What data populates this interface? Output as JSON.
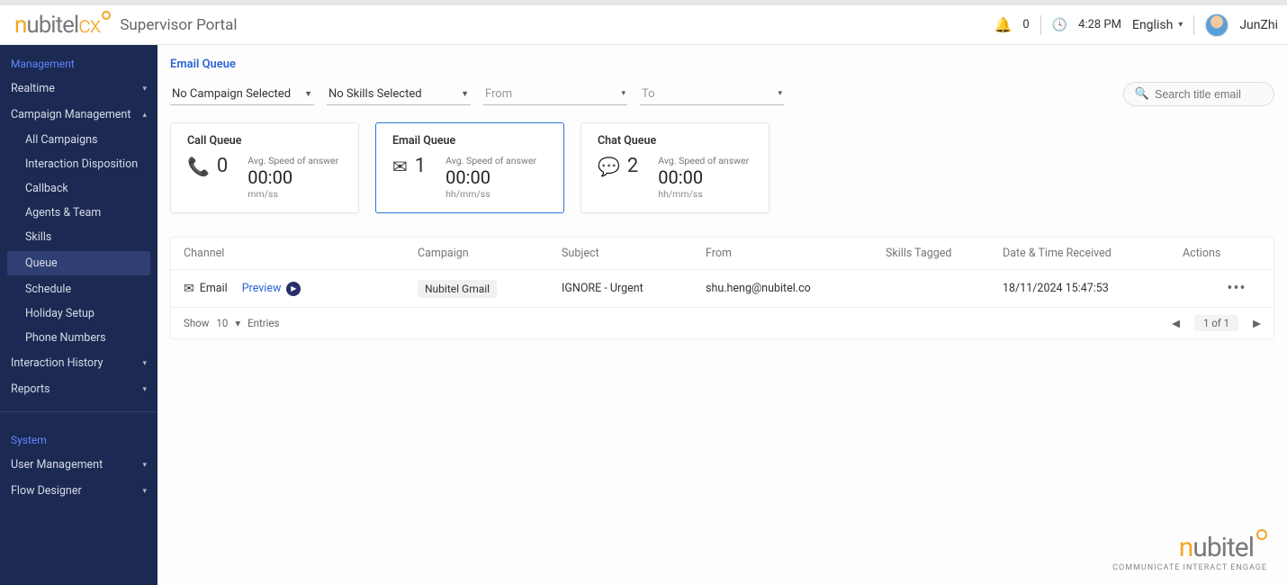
{
  "header": {
    "brand_head": "n",
    "brand_tail": "ubitel",
    "brand_cx": "cx",
    "portal": "Supervisor Portal",
    "notif_count": "0",
    "time": "4:28 PM",
    "language": "English",
    "username": "JunZhi"
  },
  "sidebar": {
    "section_management": "Management",
    "realtime": "Realtime",
    "campaign_mgmt": "Campaign Management",
    "subs": {
      "all_campaigns": "All Campaigns",
      "interaction_disposition": "Interaction Disposition",
      "callback": "Callback",
      "agents_team": "Agents & Team",
      "skills": "Skills",
      "queue": "Queue",
      "schedule": "Schedule",
      "holiday_setup": "Holiday Setup",
      "phone_numbers": "Phone Numbers"
    },
    "interaction_history": "Interaction History",
    "reports": "Reports",
    "section_system": "System",
    "user_management": "User Management",
    "flow_designer": "Flow Designer"
  },
  "page": {
    "title": "Email Queue",
    "filters": {
      "campaign": "No Campaign Selected",
      "skills": "No Skills Selected",
      "from": "From",
      "to": "To",
      "search_placeholder": "Search title email"
    },
    "cards": {
      "call": {
        "title": "Call Queue",
        "count": "0",
        "metric_label": "Avg. Speed of answer",
        "metric_value": "00:00",
        "metric_unit": "mm/ss"
      },
      "email": {
        "title": "Email Queue",
        "count": "1",
        "metric_label": "Avg. Speed of answer",
        "metric_value": "00:00",
        "metric_unit": "hh/mm/ss"
      },
      "chat": {
        "title": "Chat Queue",
        "count": "2",
        "metric_label": "Avg. Speed of answer",
        "metric_value": "00:00",
        "metric_unit": "hh/mm/ss"
      }
    },
    "table": {
      "headers": {
        "channel": "Channel",
        "campaign": "Campaign",
        "subject": "Subject",
        "from": "From",
        "skills": "Skills Tagged",
        "received": "Date & Time Received",
        "actions": "Actions"
      },
      "row": {
        "channel_label": "Email",
        "preview": "Preview",
        "campaign": "Nubitel Gmail",
        "subject": "IGNORE - Urgent",
        "from": "shu.heng@nubitel.co",
        "skills": "",
        "received": "18/11/2024 15:47:53"
      },
      "footer": {
        "show": "Show",
        "page_size": "10",
        "entries": "Entries",
        "page_info": "1 of 1"
      }
    }
  },
  "footer_brand": {
    "head": "n",
    "tail": "ubitel",
    "tag": "COMMUNICATE  INTERACT  ENGAGE"
  }
}
